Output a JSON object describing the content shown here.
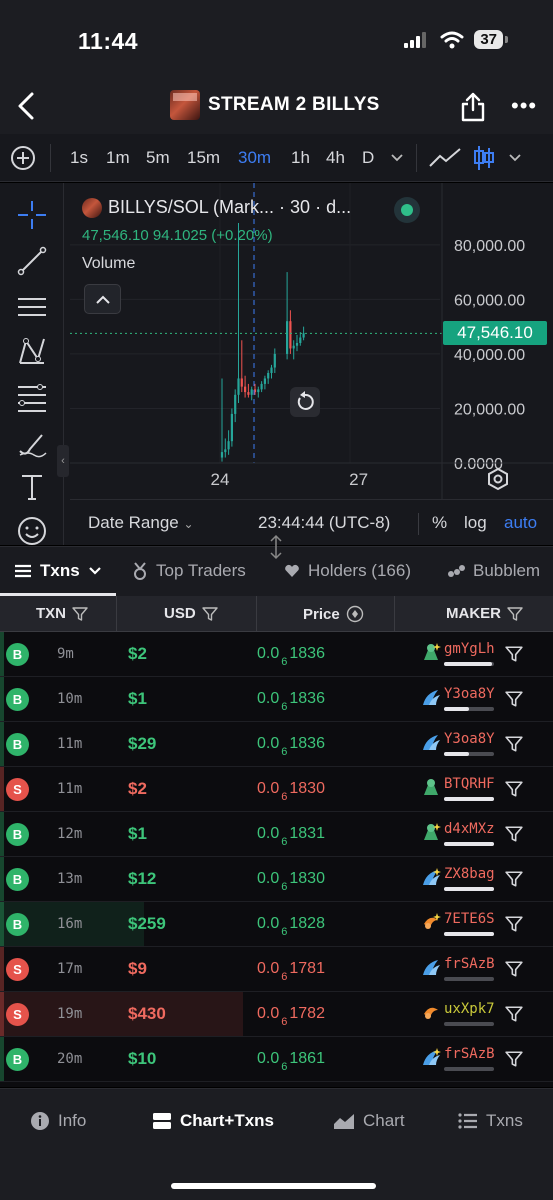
{
  "status_bar": {
    "time": "11:44",
    "battery": "37"
  },
  "nav": {
    "title": "STREAM 2 BILLYS"
  },
  "toolbar": {
    "intervals": [
      "1s",
      "1m",
      "5m",
      "15m",
      "30m",
      "1h",
      "4h",
      "D"
    ],
    "active_interval": "30m"
  },
  "chart": {
    "symbol_label": "BILLYS/SOL (Mark... · 30 · d...",
    "ohlc_text": "47,546.10 94.1025 (+0.20%)",
    "volume_label": "Volume",
    "current_price_tag": "47,546.10",
    "footer": {
      "date_range_label": "Date Range",
      "timezone": "23:44:44 (UTC-8)",
      "percent_label": "%",
      "log_label": "log",
      "auto_label": "auto"
    }
  },
  "chart_data": {
    "type": "candlestick",
    "y_ticks": [
      "80,000.00",
      "60,000.00",
      "40,000.00",
      "20,000.00",
      "0.0000"
    ],
    "x_ticks": [
      "24",
      "27"
    ],
    "ylim": [
      0,
      88000
    ],
    "x_tick_positions_in_candles": [
      0,
      42
    ],
    "candles": [
      {
        "o": 2000,
        "h": 31000,
        "l": 500,
        "c": 4000
      },
      {
        "o": 4000,
        "h": 9000,
        "l": 2000,
        "c": 5000
      },
      {
        "o": 5000,
        "h": 12000,
        "l": 3000,
        "c": 8000
      },
      {
        "o": 8000,
        "h": 20000,
        "l": 6000,
        "c": 18000
      },
      {
        "o": 18000,
        "h": 27000,
        "l": 15000,
        "c": 25000
      },
      {
        "o": 25000,
        "h": 88000,
        "l": 22000,
        "c": 31000
      },
      {
        "o": 31000,
        "h": 45000,
        "l": 26000,
        "c": 28000
      },
      {
        "o": 28000,
        "h": 32000,
        "l": 24000,
        "c": 26000
      },
      {
        "o": 26000,
        "h": 29000,
        "l": 24000,
        "c": 25000
      },
      {
        "o": 25000,
        "h": 28000,
        "l": 23000,
        "c": 27000
      },
      {
        "o": 27000,
        "h": 29000,
        "l": 25000,
        "c": 26000
      },
      {
        "o": 26000,
        "h": 28000,
        "l": 24000,
        "c": 27000
      },
      {
        "o": 27000,
        "h": 30000,
        "l": 26000,
        "c": 29000
      },
      {
        "o": 29000,
        "h": 32000,
        "l": 27000,
        "c": 31000
      },
      {
        "o": 31000,
        "h": 34000,
        "l": 29000,
        "c": 33000
      },
      {
        "o": 33000,
        "h": 36000,
        "l": 31000,
        "c": 35000
      },
      {
        "o": 35000,
        "h": 42000,
        "l": 33000,
        "c": 40000
      },
      {
        "o": 40000,
        "h": 70000,
        "l": 38000,
        "c": 52000
      },
      {
        "o": 52000,
        "h": 56000,
        "l": 40000,
        "c": 42000
      },
      {
        "o": 42000,
        "h": 45000,
        "l": 38000,
        "c": 43000
      },
      {
        "o": 43000,
        "h": 47000,
        "l": 41000,
        "c": 44000
      },
      {
        "o": 44000,
        "h": 48000,
        "l": 43000,
        "c": 46000
      },
      {
        "o": 46000,
        "h": 50000,
        "l": 45000,
        "c": 47546
      }
    ]
  },
  "tabs": [
    {
      "label": "Txns",
      "active": true
    },
    {
      "label": "Top Traders"
    },
    {
      "label": "Holders (166)"
    },
    {
      "label": "Bubblem"
    }
  ],
  "table": {
    "headers": {
      "txn": "TXN",
      "usd": "USD",
      "price": "Price",
      "maker": "MAKER"
    },
    "rows": [
      {
        "type": "B",
        "age": "9m",
        "usd": "$2",
        "price_prefix": "0.0",
        "price_sub": "6",
        "price_tail": "1836",
        "maker": "gmYgLh",
        "maker_color": "#ef6a5f",
        "maker_icon": "ape-sparkle",
        "fill": 0.95,
        "bg_fraction": 0.0
      },
      {
        "type": "B",
        "age": "10m",
        "usd": "$1",
        "price_prefix": "0.0",
        "price_sub": "6",
        "price_tail": "1836",
        "maker": "Y3oa8Y",
        "maker_color": "#ef6a5f",
        "maker_icon": "dolphin",
        "fill": 0.5,
        "bg_fraction": 0.0
      },
      {
        "type": "B",
        "age": "11m",
        "usd": "$29",
        "price_prefix": "0.0",
        "price_sub": "6",
        "price_tail": "1836",
        "maker": "Y3oa8Y",
        "maker_color": "#ef6a5f",
        "maker_icon": "dolphin",
        "fill": 0.5,
        "bg_fraction": 0.0
      },
      {
        "type": "S",
        "age": "11m",
        "usd": "$2",
        "price_prefix": "0.0",
        "price_sub": "6",
        "price_tail": "1830",
        "maker": "BTQRHF",
        "maker_color": "#ef6a5f",
        "maker_icon": "ape",
        "fill": 1.0,
        "bg_fraction": 0.0
      },
      {
        "type": "B",
        "age": "12m",
        "usd": "$1",
        "price_prefix": "0.0",
        "price_sub": "6",
        "price_tail": "1831",
        "maker": "d4xMXz",
        "maker_color": "#ef6a5f",
        "maker_icon": "ape-sparkle",
        "fill": 1.0,
        "bg_fraction": 0.0
      },
      {
        "type": "B",
        "age": "13m",
        "usd": "$12",
        "price_prefix": "0.0",
        "price_sub": "6",
        "price_tail": "1830",
        "maker": "ZX8bag",
        "maker_color": "#ef6a5f",
        "maker_icon": "dolphin-sparkle",
        "fill": 1.0,
        "bg_fraction": 0.0
      },
      {
        "type": "B",
        "age": "16m",
        "usd": "$259",
        "price_prefix": "0.0",
        "price_sub": "6",
        "price_tail": "1828",
        "maker": "7ETE6S",
        "maker_color": "#ef6a5f",
        "maker_icon": "shrimp-sparkle",
        "fill": 1.0,
        "bg_fraction": 0.26
      },
      {
        "type": "S",
        "age": "17m",
        "usd": "$9",
        "price_prefix": "0.0",
        "price_sub": "6",
        "price_tail": "1781",
        "maker": "frSAzB",
        "maker_color": "#ef6a5f",
        "maker_icon": "dolphin",
        "fill": 0.0,
        "bg_fraction": 0.0
      },
      {
        "type": "S",
        "age": "19m",
        "usd": "$430",
        "price_prefix": "0.0",
        "price_sub": "6",
        "price_tail": "1782",
        "maker": "uxXpk7",
        "maker_color": "#c9c93a",
        "maker_icon": "shrimp",
        "fill": 0.0,
        "bg_fraction": 0.44
      },
      {
        "type": "B",
        "age": "20m",
        "usd": "$10",
        "price_prefix": "0.0",
        "price_sub": "6",
        "price_tail": "1861",
        "maker": "frSAzB",
        "maker_color": "#ef6a5f",
        "maker_icon": "dolphin-sparkle",
        "fill": 0.0,
        "bg_fraction": 0.0
      }
    ]
  },
  "bottom_nav": [
    {
      "label": "Info",
      "icon": "info-icon"
    },
    {
      "label": "Chart+Txns",
      "icon": "split-view-icon",
      "active": true
    },
    {
      "label": "Chart",
      "icon": "chart-icon"
    },
    {
      "label": "Txns",
      "icon": "list-icon"
    }
  ],
  "colors": {
    "buy": "#3dc57a",
    "sell": "#ef6a5f",
    "accent": "#3d7df2",
    "price_tag": "#16a37f"
  }
}
